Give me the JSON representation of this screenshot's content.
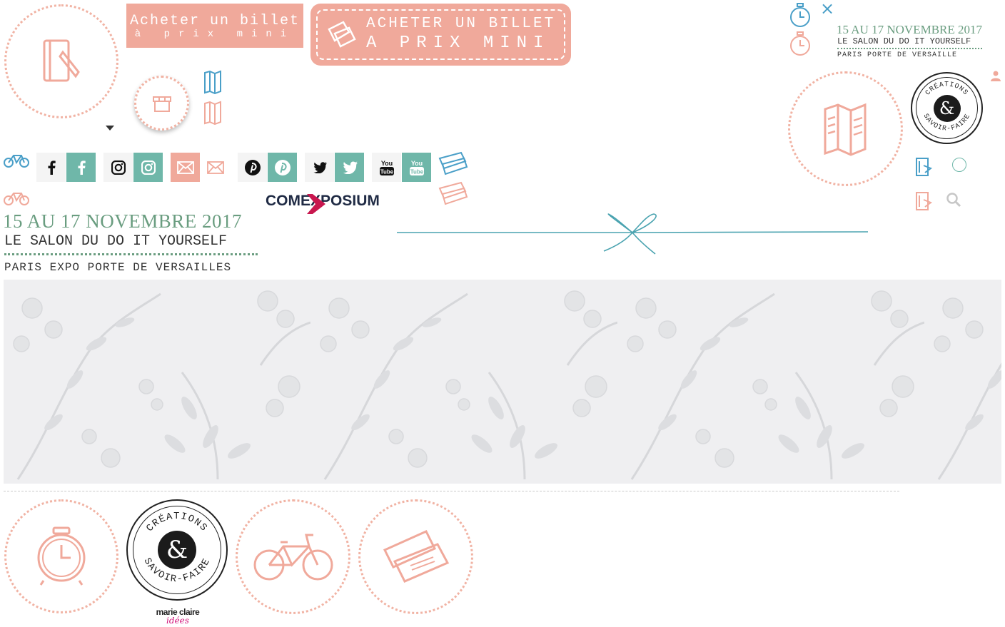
{
  "buttons": {
    "ticket_small_line1": "Acheter un billet",
    "ticket_small_line2": "à prix mini",
    "ticket_big_line1": "ACHETER UN BILLET",
    "ticket_big_line2": "A PRIX MINI"
  },
  "event": {
    "dates": "15 AU 17 NOVEMBRE 2017",
    "title": "LE SALON DU DO IT YOURSELF",
    "place": "PARIS EXPO PORTE DE VERSAILLES"
  },
  "event_small": {
    "dates": "15 AU 17 NOVEMBRE 2017",
    "title": "LE SALON DU DO IT YOURSELF",
    "place": "PARIS PORTE DE VERSAILLE"
  },
  "close_symbol": "×",
  "logos": {
    "comexposium": "COMEXPOSIUM",
    "stamp_top": "CRÉATIONS",
    "stamp_bottom": "SAVOIR-FAIRE",
    "stamp_amp": "&",
    "marieclaire_line1": "marie claire",
    "marieclaire_line2": "idées"
  },
  "colors": {
    "pink": "#f0a99b",
    "teal": "#6fb7a9",
    "green_text": "#6a9d80",
    "dot_circle": "#f1b3a4"
  },
  "icons": [
    "notebook-icon",
    "shop-icon",
    "map-icon",
    "bicycle-icon",
    "facebook-icon",
    "instagram-icon",
    "mail-icon",
    "pinterest-icon",
    "twitter-icon",
    "youtube-icon",
    "ticket-icon",
    "clock-icon",
    "user-icon",
    "search-icon",
    "door-icon",
    "bow-icon"
  ]
}
